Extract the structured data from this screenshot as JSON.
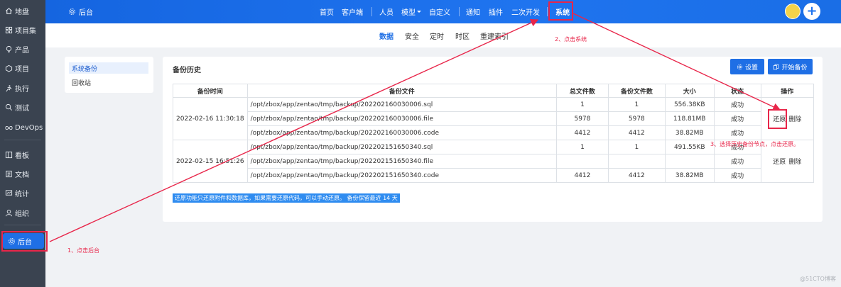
{
  "sidebar": {
    "items": [
      {
        "label": "地盘",
        "icon": "home-icon"
      },
      {
        "label": "项目集",
        "icon": "grid-icon"
      },
      {
        "label": "产品",
        "icon": "lightbulb-icon"
      },
      {
        "label": "项目",
        "icon": "cube-icon"
      },
      {
        "label": "执行",
        "icon": "run-icon"
      },
      {
        "label": "测试",
        "icon": "search-icon"
      },
      {
        "label": "DevOps",
        "icon": "infinity-icon"
      },
      {
        "label": "看板",
        "icon": "board-icon"
      },
      {
        "label": "文档",
        "icon": "doc-icon"
      },
      {
        "label": "统计",
        "icon": "chart-icon"
      },
      {
        "label": "组织",
        "icon": "user-icon"
      },
      {
        "label": "后台",
        "icon": "gear-icon"
      }
    ],
    "active": "后台"
  },
  "topbar": {
    "title": "后台",
    "nav": [
      "首页",
      "客户端",
      "人员",
      "模型",
      "自定义",
      "通知",
      "插件",
      "二次开发",
      "系统"
    ],
    "active": "系统",
    "accent": "#1f6fe5"
  },
  "subnav": {
    "items": [
      "数据",
      "安全",
      "定时",
      "时区",
      "重建索引"
    ],
    "active": "数据"
  },
  "leftpanel": {
    "items": [
      "系统备份",
      "回收站"
    ],
    "active": "系统备份"
  },
  "main": {
    "title": "备份历史",
    "settings_label": "设置",
    "start_backup_label": "开始备份",
    "columns": [
      "备份时间",
      "备份文件",
      "总文件数",
      "备份文件数",
      "大小",
      "状态",
      "操作"
    ],
    "groups": [
      {
        "time": "2022-02-16 11:30:18",
        "rows": [
          {
            "file": "/opt/zbox/app/zentao/tmp/backup/202202160030006.sql",
            "total": "1",
            "count": "1",
            "size": "556.38KB",
            "status": "成功"
          },
          {
            "file": "/opt/zbox/app/zentao/tmp/backup/202202160030006.file",
            "total": "5978",
            "count": "5978",
            "size": "118.81MB",
            "status": "成功"
          },
          {
            "file": "/opt/zbox/app/zentao/tmp/backup/202202160030006.code",
            "total": "4412",
            "count": "4412",
            "size": "38.82MB",
            "status": "成功"
          }
        ],
        "restore": "还原",
        "delete": "删除"
      },
      {
        "time": "2022-02-15 16:51:26",
        "rows": [
          {
            "file": "/opt/zbox/app/zentao/tmp/backup/202202151650340.sql",
            "total": "1",
            "count": "1",
            "size": "491.55KB",
            "status": "成功"
          },
          {
            "file": "/opt/zbox/app/zentao/tmp/backup/202202151650340.file",
            "total": "",
            "count": "",
            "size": "",
            "status": "成功"
          },
          {
            "file": "/opt/zbox/app/zentao/tmp/backup/202202151650340.code",
            "total": "4412",
            "count": "4412",
            "size": "38.82MB",
            "status": "成功"
          }
        ],
        "restore": "还原",
        "delete": "删除"
      }
    ],
    "note": "还原功能只还原附件和数据库，如果需要还原代码，可以手动还原。 备份保留最近 14 天"
  },
  "annotations": {
    "step1": "1、点击后台",
    "step2": "2、点击系统",
    "step3": "3、选择历史备份节点，点击还原。",
    "color": "#e8264a"
  },
  "watermark": "@51CTO博客"
}
